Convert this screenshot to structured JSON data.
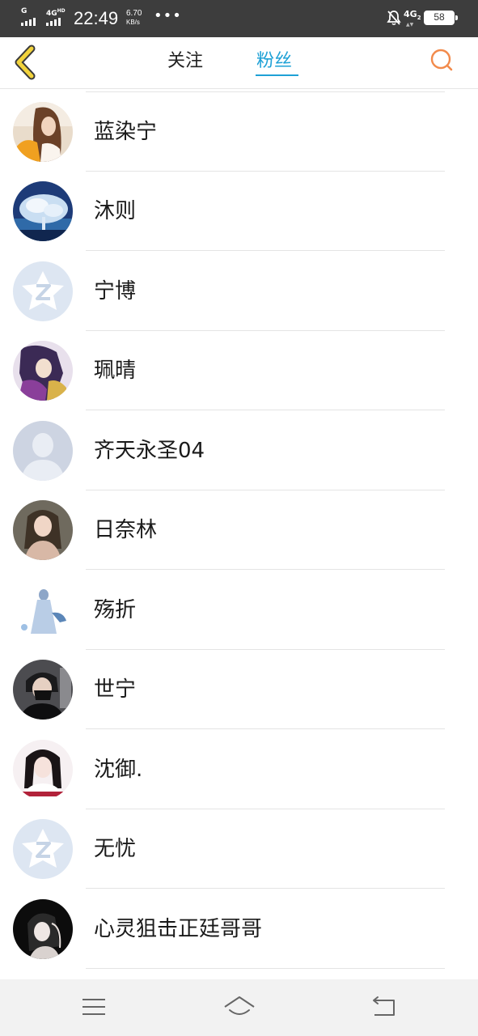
{
  "status_bar": {
    "signal1_label": "G",
    "signal2_label": "4G",
    "signal2_sup": "HD",
    "time": "22:49",
    "net_speed": "6.70",
    "net_speed_unit": "KB/s",
    "overflow_dots": "•••",
    "network_type": "4G",
    "network_sub": "2",
    "battery": "58",
    "battery_level_percent": 58,
    "icon_bell": "bell-muted-icon"
  },
  "header": {
    "back_icon": "chevron-left-icon",
    "tabs": [
      {
        "label": "关注",
        "active": false
      },
      {
        "label": "粉丝",
        "active": true
      }
    ],
    "search_icon": "search-icon",
    "accent_color": "#1ea1d6",
    "back_color": "#f2d33c",
    "search_color": "#f28a4b"
  },
  "fans": [
    {
      "name": "蓝染宁",
      "avatar": "avatar-girl-orange"
    },
    {
      "name": "沐则",
      "avatar": "avatar-blue-tree"
    },
    {
      "name": "宁博",
      "avatar": "avatar-default-qq"
    },
    {
      "name": "珮晴",
      "avatar": "avatar-anime-purple"
    },
    {
      "name": "齐天永圣04",
      "avatar": "avatar-default-person"
    },
    {
      "name": "日奈林",
      "avatar": "avatar-girl-portrait"
    },
    {
      "name": "殇折",
      "avatar": "avatar-anime-blue-dress"
    },
    {
      "name": "世宁",
      "avatar": "avatar-boy-mask"
    },
    {
      "name": "沈御.",
      "avatar": "avatar-girl-black-hair"
    },
    {
      "name": "无忧",
      "avatar": "avatar-default-qq"
    },
    {
      "name": "心灵狙击正廷哥哥",
      "avatar": "avatar-anime-black"
    }
  ],
  "nav_bar": {
    "menu_icon": "menu-icon",
    "home_icon": "home-icon",
    "back_icon": "return-icon"
  }
}
